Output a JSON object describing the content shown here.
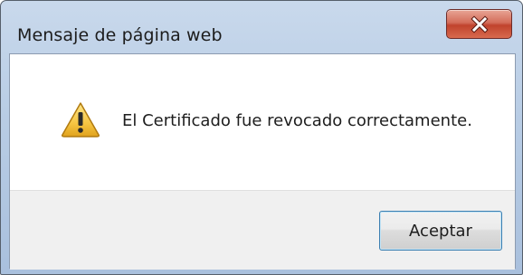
{
  "window": {
    "title": "Mensaje de página web",
    "close_icon": "close-icon"
  },
  "message": {
    "icon": "warning-icon",
    "text": "El Certificado fue revocado correctamente."
  },
  "buttons": {
    "ok_label": "Aceptar"
  },
  "colors": {
    "titlebar": "#b9cde5",
    "close_button": "#c0432d",
    "warning_fill": "#f6c543",
    "button_border": "#3c7fb1"
  }
}
